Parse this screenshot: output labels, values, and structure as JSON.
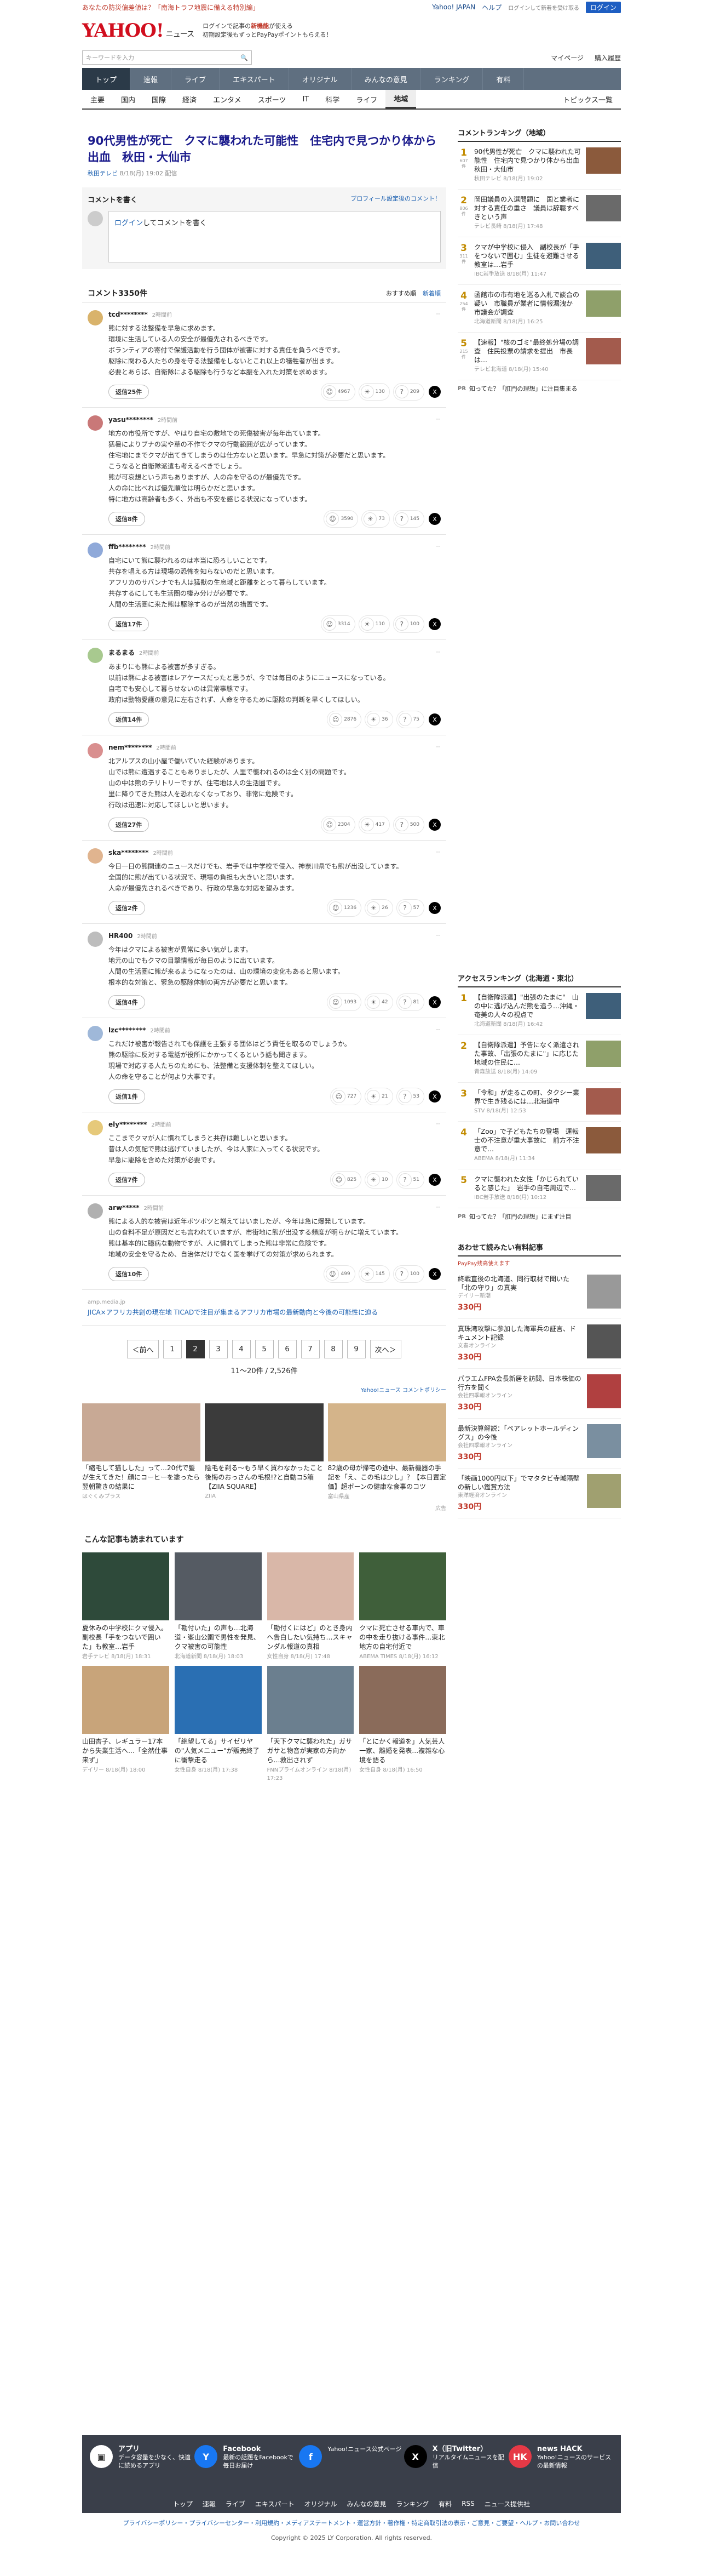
{
  "topstrip": {
    "alert": "あなたの防災偏差値は？「南海トラフ地震に備える特別編」",
    "links": [
      "Yahoo! JAPAN",
      "ヘルプ"
    ],
    "notice": "ログインして新着を受け取る",
    "login": "ログイン"
  },
  "header": {
    "logo": "YAHOO!",
    "logo_sub": "JAPAN",
    "brand": "ニュース",
    "promo_1": "ログインで記事の",
    "promo_1b": "新機能",
    "promo_1c": "が使える",
    "promo_2": "初期設定後もずっとPayPayポイントもらえる！"
  },
  "search": {
    "placeholder": "キーワードを入力",
    "links": [
      "マイページ",
      "購入履歴"
    ]
  },
  "nav": [
    {
      "label": "トップ",
      "active": true
    },
    {
      "label": "速報",
      "active": false
    },
    {
      "label": "ライブ",
      "active": false
    },
    {
      "label": "エキスパート",
      "active": false
    },
    {
      "label": "オリジナル",
      "active": false
    },
    {
      "label": "みんなの意見",
      "active": false
    },
    {
      "label": "ランキング",
      "active": false
    },
    {
      "label": "有料",
      "active": false
    }
  ],
  "subnav": [
    {
      "label": "主要",
      "active": false
    },
    {
      "label": "国内",
      "active": false
    },
    {
      "label": "国際",
      "active": false
    },
    {
      "label": "経済",
      "active": false
    },
    {
      "label": "エンタメ",
      "active": false
    },
    {
      "label": "スポーツ",
      "active": false
    },
    {
      "label": "IT",
      "active": false
    },
    {
      "label": "科学",
      "active": false
    },
    {
      "label": "ライフ",
      "active": false
    },
    {
      "label": "地域",
      "active": true
    }
  ],
  "subnav_right": "トピックス一覧",
  "article": {
    "title": "90代男性が死亡　クマに襲われた可能性　住宅内で見つかり体から出血　秋田・大仙市",
    "source": "秋田テレビ",
    "date": "8/18(月) 19:02 配信"
  },
  "comment_box": {
    "heading": "コメントを書く",
    "profile_link": "プロフィール設定後のコメント！",
    "login_text": "ログイン",
    "placeholder": "してコメントを書く"
  },
  "comments_header": {
    "count": "コメント3350件",
    "sort": [
      "おすすめ順",
      "新着順"
    ]
  },
  "comments": [
    {
      "user": "tcd********",
      "time": "2時間前",
      "text": "熊に対する法整備を早急に求めます。\n環境に生活している人の安全が最優先されるべきです。\nボランティアの寄付で保護活動を行う団体が被害に対する責任を負うべきです。\n駆除に関わる人たちの身を守る法整備をしないとこれ以上の犠牲者が出ます。\n必要とあらば、自衛隊による駆除も行うなど本腰を入れた対策を求めます。",
      "replies": "返信25件",
      "r": [
        "4967",
        "130",
        "209"
      ]
    },
    {
      "user": "yasu********",
      "time": "2時間前",
      "text": "地方の市役所ですが、やはり自宅の敷地での死傷被害が毎年出ています。\n猛暑によりブナの実や草の不作でクマの行動範囲が広がっています。\n住宅地にまでクマが出てきてしまうのは仕方ないと思います。早急に対策が必要だと思います。\nこうなると自衛隊派遣も考えるべきでしょう。\n熊が可哀想という声もありますが、人の命を守るのが最優先です。\n人の命に比べれば優先順位は明らかだと思います。\n特に地方は高齢者も多く、外出も不安を感じる状況になっています。",
      "replies": "返信8件",
      "r": [
        "3590",
        "73",
        "145"
      ]
    },
    {
      "user": "ffb********",
      "time": "2時間前",
      "text": "自宅にいて熊に襲われるのは本当に恐ろしいことです。\n共存を唱える方は現場の恐怖を知らないのだと思います。\nアフリカのサバンナでも人は猛獣の生息域と距離をとって暮らしています。\n共存するにしても生活圏の棲み分けが必要です。\n人間の生活圏に来た熊は駆除するのが当然の措置です。",
      "replies": "返信17件",
      "r": [
        "3314",
        "110",
        "100"
      ]
    },
    {
      "user": "まるまる",
      "time": "2時間前",
      "text": "あまりにも熊による被害が多すぎる。\n以前は熊による被害はレアケースだったと思うが、今では毎日のようにニュースになっている。\n自宅でも安心して暮らせないのは異常事態です。\n政府は動物愛護の意見に左右されず、人命を守るために駆除の判断を早くしてほしい。",
      "replies": "返信14件",
      "r": [
        "2876",
        "36",
        "75"
      ]
    },
    {
      "user": "nem********",
      "time": "2時間前",
      "text": "北アルプスの山小屋で働いていた経験があります。\n山では熊に遭遇することもありましたが、人里で襲われるのは全く別の問題です。\n山の中は熊のテリトリーですが、住宅地は人の生活圏です。\n里に降りてきた熊は人を恐れなくなっており、非常に危険です。\n行政は迅速に対応してほしいと思います。",
      "replies": "返信27件",
      "r": [
        "2304",
        "417",
        "500"
      ]
    },
    {
      "user": "ska********",
      "time": "2時間前",
      "text": "今日一日の熊関連のニュースだけでも、岩手では中学校で侵入、神奈川県でも熊が出没しています。\n全国的に熊が出ている状況で、現場の負担も大きいと思います。\n人命が最優先されるべきであり、行政の早急な対応を望みます。",
      "replies": "返信2件",
      "r": [
        "1236",
        "26",
        "57"
      ]
    },
    {
      "user": "HR400",
      "time": "2時間前",
      "text": "今年はクマによる被害が異常に多い気がします。\n地元の山でもクマの目撃情報が毎日のように出ています。\n人間の生活圏に熊が来るようになったのは、山の環境の変化もあると思います。\n根本的な対策と、緊急の駆除体制の両方が必要だと思います。",
      "replies": "返信4件",
      "r": [
        "1093",
        "42",
        "81"
      ]
    },
    {
      "user": "lzc********",
      "time": "2時間前",
      "text": "これだけ被害が報告されても保護を主張する団体はどう責任を取るのでしょうか。\n熊の駆除に反対する電話が役所にかかってくるという話も聞きます。\n現場で対応する人たちのためにも、法整備と支援体制を整えてほしい。\n人の命を守ることが何より大事です。",
      "replies": "返信1件",
      "r": [
        "727",
        "21",
        "53"
      ]
    },
    {
      "user": "ely********",
      "time": "2時間前",
      "text": "ここまでクマが人に慣れてしまうと共存は難しいと思います。\n昔は人の気配で熊は逃げていましたが、今は人家に入ってくる状況です。\n早急に駆除を含めた対策が必要です。",
      "replies": "返信7件",
      "r": [
        "825",
        "10",
        "51"
      ]
    },
    {
      "user": "arw*****",
      "time": "2時間前",
      "text": "熊による人的な被害は近年ボツボツと増えてはいましたが、今年は急に爆発しています。\n山の食料不足が原因だとも言われていますが、市街地に熊が出没する頻度が明らかに増えています。\n熊は基本的に臆病な動物ですが、人に慣れてしまった熊は非常に危険です。\n地域の安全を守るため、自治体だけでなく国を挙げての対策が求められます。",
      "replies": "返信10件",
      "r": [
        "499",
        "145",
        "100"
      ]
    }
  ],
  "ad_line": {
    "source": "amp.media.jp",
    "text": "JICA×アフリカ共創の現在地 TICADで注目が集まるアフリカ市場の最新動向と今後の可能性に迫る"
  },
  "pager": {
    "prev": "＜前へ",
    "pages": [
      "1",
      "2",
      "3",
      "4",
      "5",
      "6",
      "7",
      "8",
      "9"
    ],
    "current": "2",
    "next": "次へ＞",
    "note": "11〜20件 / 2,526件"
  },
  "policy_link": "Yahoo!ニュース コメントポリシー",
  "ad_cards": [
    {
      "title": "「縮毛して猫しした」って…20代で髪が生えてきた！顔にコーヒーを塗ったら翌朝驚きの結果に",
      "source": "はぐくみプラス"
    },
    {
      "title": "陰毛を剃る〜もう早く買わなかったこと後悔のおっさんの毛根!?と自動コ5箱【ZIIA SQUARE】",
      "source": "ZIIA"
    },
    {
      "title": "82歳の母が帰宅の途中、最新機器の手記を「え、この毛は少し」？【本日置定価】超ボーンの健康な食事のコツ",
      "source": "富山県産"
    }
  ],
  "ad_note": "広告",
  "also_read": {
    "heading": "こんな記事も読まれています",
    "items": [
      {
        "title": "夏休みの中学校にクマ侵入。副校長「手をつないで囲いた」も教室…岩手",
        "source": "岩手テレビ 8/18(月) 18:31"
      },
      {
        "title": "「勘付いた」の声も…北海道・峯山公園で男性を発見、クマ被害の可能性",
        "source": "北海道新聞 8/18(月) 18:03"
      },
      {
        "title": "「勘付くにはど」のとき身内へ告白したい気持ち…スキャンダル報道の真相",
        "source": "女性自身 8/18(月) 17:48"
      },
      {
        "title": "クマに死亡させる車内で、車の中を走り抜ける事件…東北地方の自宅付近で",
        "source": "ABEMA TIMES 8/18(月) 16:12"
      },
      {
        "title": "山田杏子、レギュラー17本から失業生活へ…「全然仕事来ず」",
        "source": "デイリー 8/18(月) 18:00"
      },
      {
        "title": "「絶望してる」サイゼリヤの\"人気メニュー\"が販売終了に衝撃走る",
        "source": "女性自身 8/18(月) 17:38"
      },
      {
        "title": "「天下クマに襲われた」ガサガサと物音が実家の方向から…救出されず",
        "source": "FNNプライムオンライン 8/18(月) 17:23"
      },
      {
        "title": "「とにかく報道を」人気芸人一家、離婚を発表…複雑な心境を語る",
        "source": "女性自身 8/18(月) 16:50"
      }
    ]
  },
  "sidebar": {
    "ranking_title": "コメントランキング（地域）",
    "ranking": [
      {
        "n": "1",
        "c": "607件",
        "title": "90代男性が死亡　クマに襲われた可能性　住宅内で見つかり体から出血　秋田・大仙市",
        "src": "秋田テレビ 8/18(月) 19:02"
      },
      {
        "n": "2",
        "c": "806件",
        "title": "岡田議員の入選問題に　国と業者に対する責任の重さ　議員は辞職すべきという声",
        "src": "テレビ長崎 8/18(月) 17:48"
      },
      {
        "n": "3",
        "c": "311件",
        "title": "クマが中学校に侵入　副校長が「手をつないで囲む」生徒を避難させる　教室は…岩手",
        "src": "IBC岩手放送 8/18(月) 11:47"
      },
      {
        "n": "4",
        "c": "254件",
        "title": "函館市の市有地を巡る入札で談合の疑い　市職員が業者に情報漏洩か　市議会が調査",
        "src": "北海道新聞 8/18(月) 16:25"
      },
      {
        "n": "5",
        "c": "215件",
        "title": "【速報】\"核のゴミ\"最終処分場の調査　住民投票の請求を提出　市長は…",
        "src": "テレビ北海道 8/18(月) 15:40"
      }
    ],
    "pr": "知ってた？「肛門の理想」に注目集まる",
    "pr_src": "PR",
    "access_title": "アクセスランキング（北海道・東北）",
    "access": [
      {
        "n": "1",
        "title": "【自衛隊派遣】\"出張のたまに\"　山の中に逃げ込んだ熊を追う…沖縄・奄美の人々の視点で",
        "src": "北海道新聞 8/18(月) 16:42"
      },
      {
        "n": "2",
        "title": "【自衛隊派遣】予告になく派遣された事故、「出張のたまに\"」に応じた地域の住民に…",
        "src": "青森放送 8/18(月) 14:09"
      },
      {
        "n": "3",
        "title": "「令和」が走るこの町、タクシー業界で生き残るには…北海道中",
        "src": "STV 8/18(月) 12:53"
      },
      {
        "n": "4",
        "title": "「Zoo」で子どもたちの登場　運転士の不注意が重大事故に　前方不注意で…",
        "src": "ABEMA 8/18(月) 11:34"
      },
      {
        "n": "5",
        "title": "クマに襲われた女性「かじられていると感じた」　岩手の自宅周辺で…",
        "src": "IBC岩手放送 8/18(月) 10:12"
      }
    ],
    "pr2": "知ってた？「肛門の理想」にまず注目",
    "shop_title": "あわせて読みたい有料記事",
    "shop_sub": "PayPay残高使えます",
    "shop": [
      {
        "title": "終戦直後の北海道、同行取材で聞いた「北の守り」の真実",
        "src": "デイリー新潮",
        "price": "330"
      },
      {
        "title": "真珠湾攻撃に参加した海軍兵の証言、ドキュメント記録",
        "src": "文春オンライン",
        "price": "330"
      },
      {
        "title": "パラエムFPA会長新居を訪問、日本株価の行方を聞く",
        "src": "会社四季報オンライン",
        "price": "330"
      },
      {
        "title": "最新決算解説：「ペアレットホールディングス」の今後",
        "src": "会社四季報オンライン",
        "price": "330"
      },
      {
        "title": "「映画1000円以下」でマタタビ寺城隔壁の新しい鑑賞方法",
        "src": "東洋経済オンライン",
        "price": "330"
      }
    ]
  },
  "footer": {
    "cols": [
      {
        "icon": "app",
        "name": "アプリ",
        "desc": "データ容量を少なく、快適に読めるアプリ"
      },
      {
        "icon": "Y",
        "name": "Facebook",
        "desc": "最新の話題をFacebookで毎日お届け"
      },
      {
        "icon": "f",
        "name": "",
        "desc": "Yahoo!ニュース公式ページ"
      },
      {
        "icon": "X",
        "name": "X（旧Twitter）",
        "desc": "リアルタイムニュースを配信"
      },
      {
        "icon": "HK",
        "name": "news HACK",
        "desc": "Yahoo!ニュースのサービスの最新情報"
      }
    ],
    "links": [
      "トップ",
      "速報",
      "ライブ",
      "エキスパート",
      "オリジナル",
      "みんなの意見",
      "ランキング",
      "有料",
      "RSS",
      "ニュース提供社"
    ],
    "legal": "プライバシーポリシー・プライバシーセンター・利用規約・メディアステートメント・運営方針・著作権・特定商取引法の表示・ご意見・ご要望・ヘルプ・お問い合わせ",
    "copyright": "Copyright © 2025 LY Corporation. All rights reserved."
  },
  "colors": {
    "brand": "#d10e1e",
    "nav": "#5f6f80",
    "link": "#1a5fb0"
  }
}
